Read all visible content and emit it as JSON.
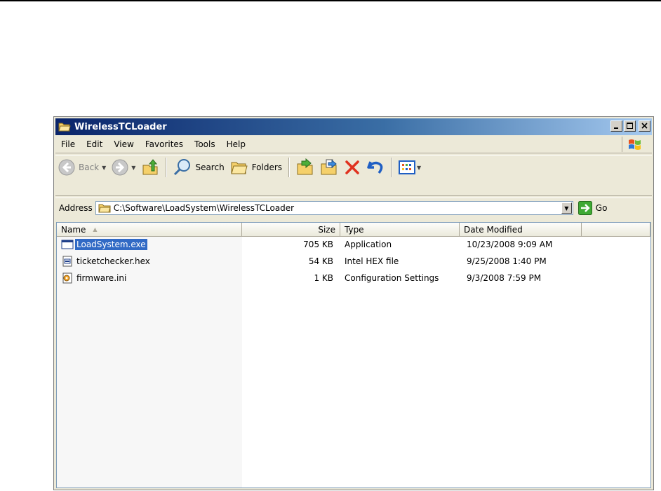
{
  "window": {
    "title": "WirelessTCLoader",
    "controls": [
      "minimize",
      "maximize",
      "close"
    ]
  },
  "menu": [
    "File",
    "Edit",
    "View",
    "Favorites",
    "Tools",
    "Help"
  ],
  "toolbar": {
    "back_label": "Back",
    "search_label": "Search",
    "folders_label": "Folders"
  },
  "address": {
    "label": "Address",
    "path": "C:\\Software\\LoadSystem\\WirelessTCLoader",
    "go_label": "Go"
  },
  "columns": [
    "Name",
    "Size",
    "Type",
    "Date Modified"
  ],
  "files": [
    {
      "name": "LoadSystem.exe",
      "size": "705 KB",
      "type": "Application",
      "date": "10/23/2008 9:09 AM",
      "icon": "exe-icon",
      "selected": true
    },
    {
      "name": "ticketchecker.hex",
      "size": "54 KB",
      "type": "Intel HEX file",
      "date": "9/25/2008 1:40 PM",
      "icon": "hex-file-icon",
      "selected": false
    },
    {
      "name": "firmware.ini",
      "size": "1 KB",
      "type": "Configuration Settings",
      "date": "9/3/2008 7:59 PM",
      "icon": "ini-file-icon",
      "selected": false
    }
  ],
  "colors": {
    "title_gradient_start": "#0a246a",
    "title_gradient_end": "#a6caf0",
    "selection": "#316ac5",
    "window_bg": "#ece9d8"
  }
}
